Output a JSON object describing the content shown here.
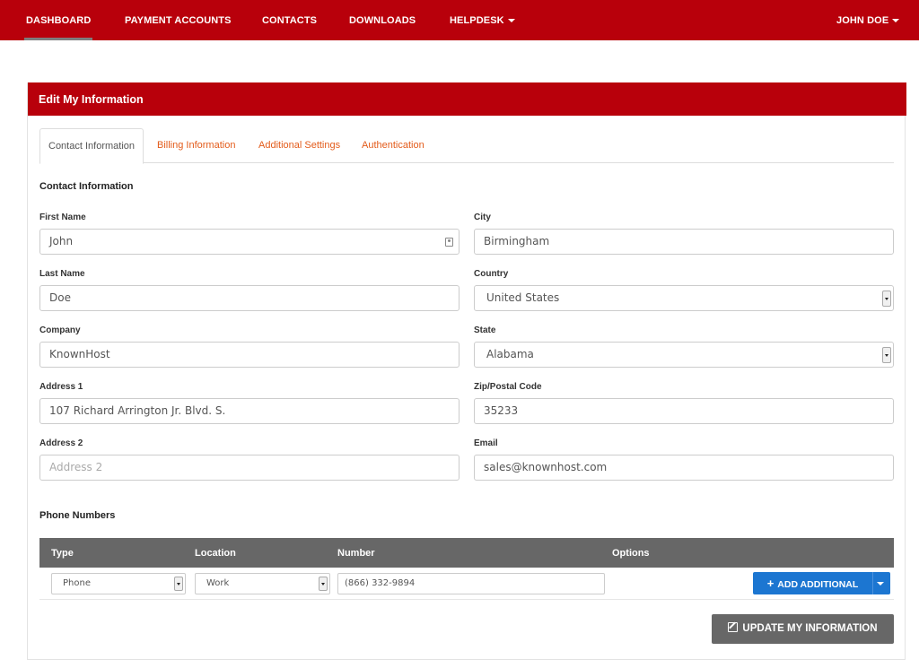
{
  "nav": {
    "items": [
      {
        "label": "DASHBOARD"
      },
      {
        "label": "PAYMENT ACCOUNTS"
      },
      {
        "label": "CONTACTS"
      },
      {
        "label": "DOWNLOADS"
      },
      {
        "label": "HELPDESK"
      }
    ],
    "user": "JOHN DOE"
  },
  "panel": {
    "title": "Edit My Information",
    "tabs": [
      {
        "label": "Contact Information"
      },
      {
        "label": "Billing Information"
      },
      {
        "label": "Additional Settings"
      },
      {
        "label": "Authentication"
      }
    ]
  },
  "contact": {
    "section_title": "Contact Information",
    "first_name": {
      "label": "First Name",
      "value": "John"
    },
    "last_name": {
      "label": "Last Name",
      "value": "Doe"
    },
    "company": {
      "label": "Company",
      "value": "KnownHost"
    },
    "address1": {
      "label": "Address 1",
      "value": "107 Richard Arrington Jr. Blvd. S."
    },
    "address2": {
      "label": "Address 2",
      "placeholder": "Address 2"
    },
    "city": {
      "label": "City",
      "value": "Birmingham"
    },
    "country": {
      "label": "Country",
      "value": "United States"
    },
    "state": {
      "label": "State",
      "value": "Alabama"
    },
    "zip": {
      "label": "Zip/Postal Code",
      "value": "35233"
    },
    "email": {
      "label": "Email",
      "value": "sales@knownhost.com"
    }
  },
  "phones": {
    "section_title": "Phone Numbers",
    "columns": [
      "Type",
      "Location",
      "Number",
      "Options"
    ],
    "rows": [
      {
        "type": "Phone",
        "location": "Work",
        "number": "(866) 332-9894"
      }
    ],
    "add_label": "ADD ADDITIONAL"
  },
  "actions": {
    "update_label": "UPDATE MY INFORMATION"
  },
  "colors": {
    "brand_red": "#b8000b",
    "tab_link": "#e35b1a",
    "button_blue": "#1c76d1",
    "button_gray": "#676767"
  },
  "icons": {
    "helpdesk_caret": "chevron-down-icon",
    "user_caret": "chevron-down-icon",
    "contact_card": "contact-card-icon",
    "add": "plus-icon",
    "update": "edit-icon"
  }
}
